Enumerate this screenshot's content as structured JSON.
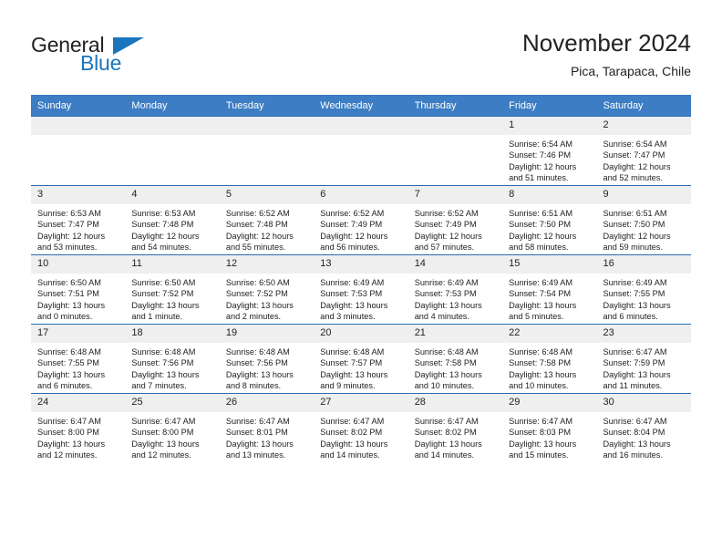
{
  "brand": {
    "name_top": "General",
    "name_bottom": "Blue",
    "color_dark": "#231f20",
    "color_blue": "#1b75bc"
  },
  "header": {
    "title": "November 2024",
    "subtitle": "Pica, Tarapaca, Chile"
  },
  "theme": {
    "header_row_bg": "#3c7dc4",
    "daynum_bg": "#efefef",
    "cell_border": "#2a6cb0"
  },
  "calendar": {
    "weekday_headers": [
      "Sunday",
      "Monday",
      "Tuesday",
      "Wednesday",
      "Thursday",
      "Friday",
      "Saturday"
    ],
    "weeks": [
      [
        {
          "day": "",
          "sunrise": "",
          "sunset": "",
          "daylight": ""
        },
        {
          "day": "",
          "sunrise": "",
          "sunset": "",
          "daylight": ""
        },
        {
          "day": "",
          "sunrise": "",
          "sunset": "",
          "daylight": ""
        },
        {
          "day": "",
          "sunrise": "",
          "sunset": "",
          "daylight": ""
        },
        {
          "day": "",
          "sunrise": "",
          "sunset": "",
          "daylight": ""
        },
        {
          "day": "1",
          "sunrise": "Sunrise: 6:54 AM",
          "sunset": "Sunset: 7:46 PM",
          "daylight": "Daylight: 12 hours and 51 minutes."
        },
        {
          "day": "2",
          "sunrise": "Sunrise: 6:54 AM",
          "sunset": "Sunset: 7:47 PM",
          "daylight": "Daylight: 12 hours and 52 minutes."
        }
      ],
      [
        {
          "day": "3",
          "sunrise": "Sunrise: 6:53 AM",
          "sunset": "Sunset: 7:47 PM",
          "daylight": "Daylight: 12 hours and 53 minutes."
        },
        {
          "day": "4",
          "sunrise": "Sunrise: 6:53 AM",
          "sunset": "Sunset: 7:48 PM",
          "daylight": "Daylight: 12 hours and 54 minutes."
        },
        {
          "day": "5",
          "sunrise": "Sunrise: 6:52 AM",
          "sunset": "Sunset: 7:48 PM",
          "daylight": "Daylight: 12 hours and 55 minutes."
        },
        {
          "day": "6",
          "sunrise": "Sunrise: 6:52 AM",
          "sunset": "Sunset: 7:49 PM",
          "daylight": "Daylight: 12 hours and 56 minutes."
        },
        {
          "day": "7",
          "sunrise": "Sunrise: 6:52 AM",
          "sunset": "Sunset: 7:49 PM",
          "daylight": "Daylight: 12 hours and 57 minutes."
        },
        {
          "day": "8",
          "sunrise": "Sunrise: 6:51 AM",
          "sunset": "Sunset: 7:50 PM",
          "daylight": "Daylight: 12 hours and 58 minutes."
        },
        {
          "day": "9",
          "sunrise": "Sunrise: 6:51 AM",
          "sunset": "Sunset: 7:50 PM",
          "daylight": "Daylight: 12 hours and 59 minutes."
        }
      ],
      [
        {
          "day": "10",
          "sunrise": "Sunrise: 6:50 AM",
          "sunset": "Sunset: 7:51 PM",
          "daylight": "Daylight: 13 hours and 0 minutes."
        },
        {
          "day": "11",
          "sunrise": "Sunrise: 6:50 AM",
          "sunset": "Sunset: 7:52 PM",
          "daylight": "Daylight: 13 hours and 1 minute."
        },
        {
          "day": "12",
          "sunrise": "Sunrise: 6:50 AM",
          "sunset": "Sunset: 7:52 PM",
          "daylight": "Daylight: 13 hours and 2 minutes."
        },
        {
          "day": "13",
          "sunrise": "Sunrise: 6:49 AM",
          "sunset": "Sunset: 7:53 PM",
          "daylight": "Daylight: 13 hours and 3 minutes."
        },
        {
          "day": "14",
          "sunrise": "Sunrise: 6:49 AM",
          "sunset": "Sunset: 7:53 PM",
          "daylight": "Daylight: 13 hours and 4 minutes."
        },
        {
          "day": "15",
          "sunrise": "Sunrise: 6:49 AM",
          "sunset": "Sunset: 7:54 PM",
          "daylight": "Daylight: 13 hours and 5 minutes."
        },
        {
          "day": "16",
          "sunrise": "Sunrise: 6:49 AM",
          "sunset": "Sunset: 7:55 PM",
          "daylight": "Daylight: 13 hours and 6 minutes."
        }
      ],
      [
        {
          "day": "17",
          "sunrise": "Sunrise: 6:48 AM",
          "sunset": "Sunset: 7:55 PM",
          "daylight": "Daylight: 13 hours and 6 minutes."
        },
        {
          "day": "18",
          "sunrise": "Sunrise: 6:48 AM",
          "sunset": "Sunset: 7:56 PM",
          "daylight": "Daylight: 13 hours and 7 minutes."
        },
        {
          "day": "19",
          "sunrise": "Sunrise: 6:48 AM",
          "sunset": "Sunset: 7:56 PM",
          "daylight": "Daylight: 13 hours and 8 minutes."
        },
        {
          "day": "20",
          "sunrise": "Sunrise: 6:48 AM",
          "sunset": "Sunset: 7:57 PM",
          "daylight": "Daylight: 13 hours and 9 minutes."
        },
        {
          "day": "21",
          "sunrise": "Sunrise: 6:48 AM",
          "sunset": "Sunset: 7:58 PM",
          "daylight": "Daylight: 13 hours and 10 minutes."
        },
        {
          "day": "22",
          "sunrise": "Sunrise: 6:48 AM",
          "sunset": "Sunset: 7:58 PM",
          "daylight": "Daylight: 13 hours and 10 minutes."
        },
        {
          "day": "23",
          "sunrise": "Sunrise: 6:47 AM",
          "sunset": "Sunset: 7:59 PM",
          "daylight": "Daylight: 13 hours and 11 minutes."
        }
      ],
      [
        {
          "day": "24",
          "sunrise": "Sunrise: 6:47 AM",
          "sunset": "Sunset: 8:00 PM",
          "daylight": "Daylight: 13 hours and 12 minutes."
        },
        {
          "day": "25",
          "sunrise": "Sunrise: 6:47 AM",
          "sunset": "Sunset: 8:00 PM",
          "daylight": "Daylight: 13 hours and 12 minutes."
        },
        {
          "day": "26",
          "sunrise": "Sunrise: 6:47 AM",
          "sunset": "Sunset: 8:01 PM",
          "daylight": "Daylight: 13 hours and 13 minutes."
        },
        {
          "day": "27",
          "sunrise": "Sunrise: 6:47 AM",
          "sunset": "Sunset: 8:02 PM",
          "daylight": "Daylight: 13 hours and 14 minutes."
        },
        {
          "day": "28",
          "sunrise": "Sunrise: 6:47 AM",
          "sunset": "Sunset: 8:02 PM",
          "daylight": "Daylight: 13 hours and 14 minutes."
        },
        {
          "day": "29",
          "sunrise": "Sunrise: 6:47 AM",
          "sunset": "Sunset: 8:03 PM",
          "daylight": "Daylight: 13 hours and 15 minutes."
        },
        {
          "day": "30",
          "sunrise": "Sunrise: 6:47 AM",
          "sunset": "Sunset: 8:04 PM",
          "daylight": "Daylight: 13 hours and 16 minutes."
        }
      ]
    ]
  }
}
